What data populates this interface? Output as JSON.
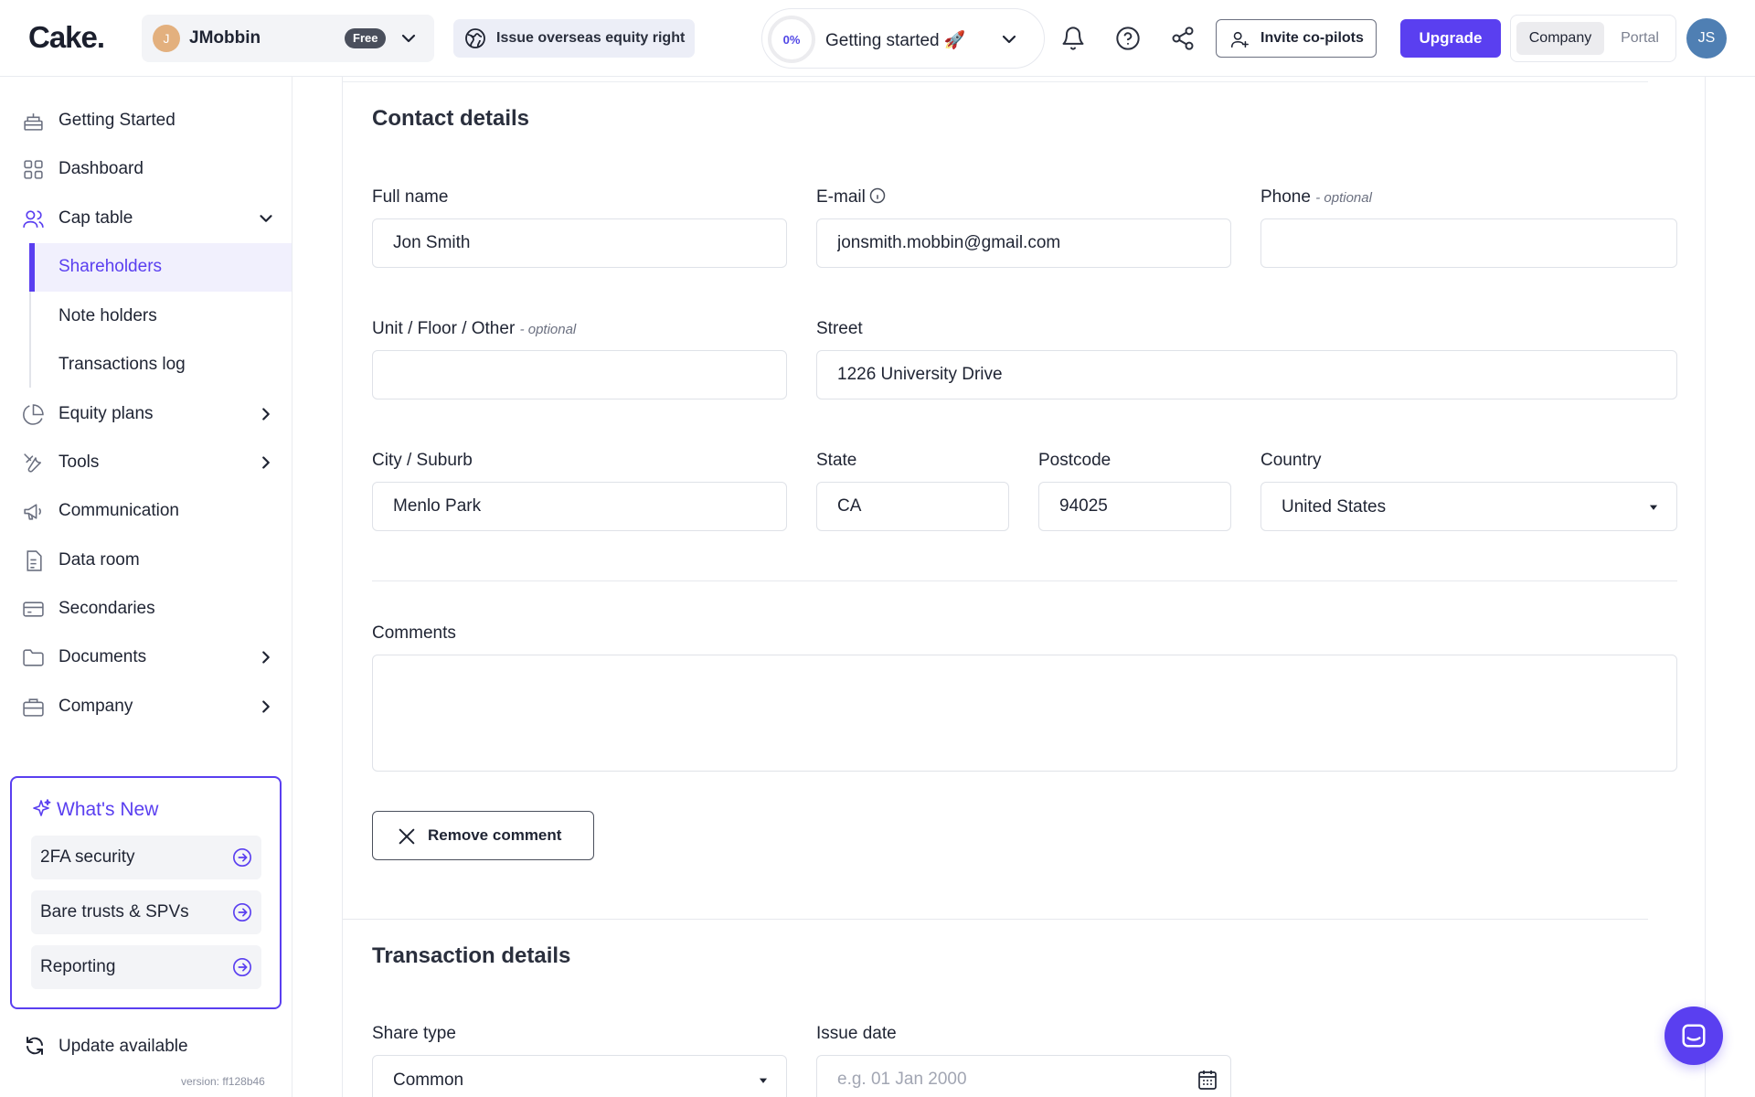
{
  "header": {
    "logo": "Cake.",
    "company": {
      "initial": "J",
      "name": "JMobbin",
      "plan": "Free"
    },
    "promo": "Issue overseas equity right",
    "progress": {
      "percent_text": "0%",
      "label": "Getting started 🚀",
      "value": 0
    },
    "invite_label": "Invite co-pilots",
    "upgrade_label": "Upgrade",
    "view_toggle": {
      "active": "Company",
      "inactive": "Portal"
    },
    "user_initials": "JS"
  },
  "sidebar": {
    "items": [
      {
        "label": "Getting Started",
        "icon": "cake-icon"
      },
      {
        "label": "Dashboard",
        "icon": "grid-icon"
      },
      {
        "label": "Cap table",
        "icon": "users-icon",
        "expanded": true
      },
      {
        "label": "Equity plans",
        "icon": "pie-chart-icon"
      },
      {
        "label": "Tools",
        "icon": "tools-icon"
      },
      {
        "label": "Communication",
        "icon": "megaphone-icon"
      },
      {
        "label": "Data room",
        "icon": "document-icon"
      },
      {
        "label": "Secondaries",
        "icon": "card-icon"
      },
      {
        "label": "Documents",
        "icon": "folder-icon"
      },
      {
        "label": "Company",
        "icon": "briefcase-icon"
      }
    ],
    "cap_table_sub": [
      {
        "label": "Shareholders",
        "active": true
      },
      {
        "label": "Note holders"
      },
      {
        "label": "Transactions log"
      }
    ],
    "whats_new": {
      "title": "What's New",
      "items": [
        "2FA security",
        "Bare trusts & SPVs",
        "Reporting"
      ]
    },
    "update_label": "Update available",
    "version": "version: ff128b46"
  },
  "contact": {
    "title": "Contact details",
    "full_name": {
      "label": "Full name",
      "value": "Jon Smith"
    },
    "email": {
      "label": "E-mail",
      "value": "jonsmith.mobbin@gmail.com"
    },
    "phone": {
      "label": "Phone",
      "optional": "- optional",
      "value": ""
    },
    "unit": {
      "label": "Unit / Floor / Other",
      "optional": "- optional",
      "value": ""
    },
    "street": {
      "label": "Street",
      "value": "1226 University Drive"
    },
    "city": {
      "label": "City / Suburb",
      "value": "Menlo Park"
    },
    "state": {
      "label": "State",
      "value": "CA"
    },
    "postcode": {
      "label": "Postcode",
      "value": "94025"
    },
    "country": {
      "label": "Country",
      "value": "United States"
    },
    "comments": {
      "label": "Comments",
      "value": ""
    },
    "remove_comment_label": "Remove comment"
  },
  "transaction": {
    "title": "Transaction details",
    "share_type": {
      "label": "Share type",
      "value": "Common"
    },
    "issue_date": {
      "label": "Issue date",
      "placeholder": "e.g. 01 Jan 2000"
    }
  },
  "colors": {
    "accent": "#5a3ff0",
    "active_bg": "#f1f0fd"
  }
}
